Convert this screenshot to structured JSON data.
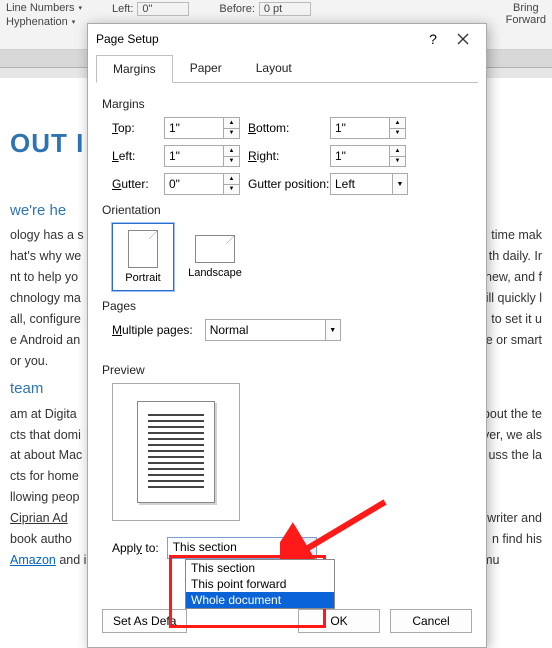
{
  "ribbon": {
    "line_numbers": "Line Numbers",
    "hyphenation": "Hyphenation",
    "left_label": "Left:",
    "left_val": "0\"",
    "before_label": "Before:",
    "before_val": "0 pt",
    "bring_forward": "Bring\nForward"
  },
  "dialog": {
    "title": "Page Setup",
    "help": "?",
    "tabs": {
      "margins": "Margins",
      "paper": "Paper",
      "layout": "Layout"
    },
    "margins": {
      "header": "Margins",
      "top_label": "Top:",
      "top_val": "1\"",
      "bottom_label": "Bottom:",
      "bottom_val": "1\"",
      "left_label": "Left:",
      "left_val": "1\"",
      "right_label": "Right:",
      "right_val": "1\"",
      "gutter_label": "Gutter:",
      "gutter_val": "0\"",
      "gutter_pos_label": "Gutter position:",
      "gutter_pos_val": "Left"
    },
    "orientation": {
      "header": "Orientation",
      "portrait": "Portrait",
      "landscape": "Landscape"
    },
    "pages": {
      "header": "Pages",
      "multiple_label": "Multiple pages:",
      "multiple_val": "Normal"
    },
    "preview": {
      "header": "Preview"
    },
    "apply": {
      "label": "Apply to:",
      "value": "This section",
      "options": [
        "This section",
        "This point forward",
        "Whole document"
      ]
    },
    "footer": {
      "set_default": "Set As Defa",
      "ok": "OK",
      "cancel": "Cancel"
    }
  },
  "bg_doc": {
    "h1": "OUT  I",
    "h2a": "we're he",
    "p1": "ology has a s",
    "p1r": "d time mak",
    "p2": "hat's why we",
    "p2r": "th daily. Ir",
    "p3": "nt to help yo",
    "p3r": "new, and f",
    "p4": "chnology ma",
    "p4r": "ill quickly l",
    "p5": "all, configure",
    "p5r": "to set it u",
    "p6": "e Android an",
    "p6r": "e or smart",
    "p7": "or you.",
    "h2b": "team",
    "p8": "am at Digita",
    "p8r": "bout the te",
    "p9": "cts that domi",
    "p9r": "ver, we als",
    "p10": "at about Mac",
    "p10r": "uss the la",
    "p11": "cts for home",
    "p12": "llowing peop",
    "p13": "Ciprian Ad",
    "p13r": "writer and",
    "p14": "book autho",
    "p14r": "n find his",
    "p15a": "Amazon",
    "p15b": " and in bookshops all over the world. However, in our team, he doesn't do as mu"
  }
}
